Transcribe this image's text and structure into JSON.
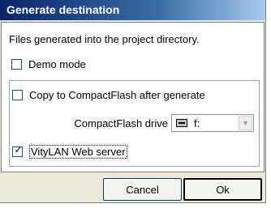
{
  "window": {
    "title": "Generate destination"
  },
  "info_text": "Files generated into the project directory.",
  "demo_mode": {
    "label": "Demo mode",
    "checked": false
  },
  "copy_cf": {
    "label": "Copy to CompactFlash after generate",
    "checked": false
  },
  "cf_drive": {
    "label": "CompactFlash drive",
    "value": "f:",
    "icon": "drive-icon"
  },
  "web_server": {
    "label": "VityLAN Web server",
    "checked": true
  },
  "buttons": {
    "cancel": "Cancel",
    "ok": "Ok"
  }
}
